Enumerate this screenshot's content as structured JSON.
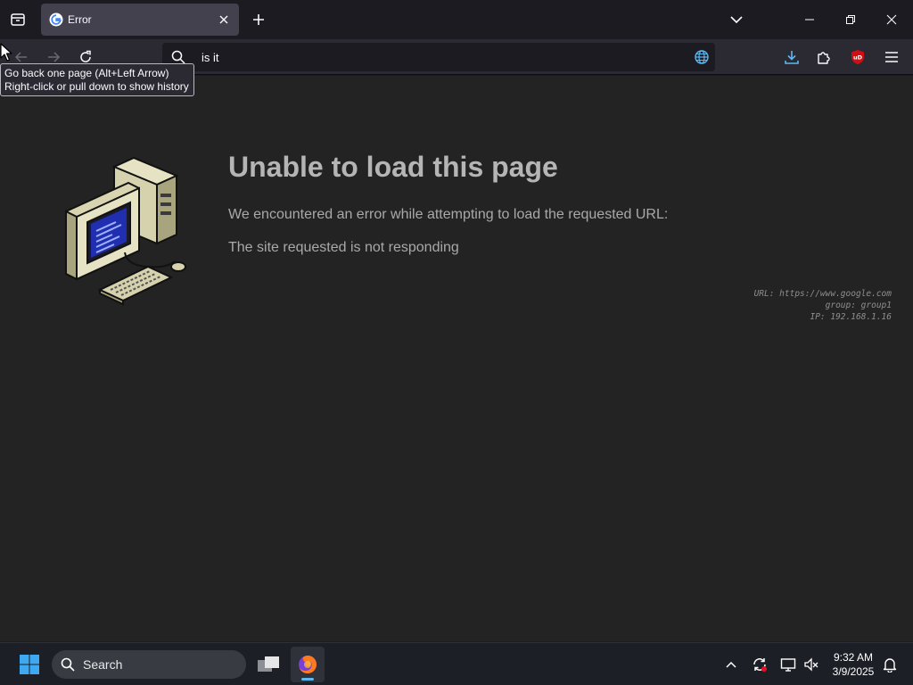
{
  "tab": {
    "title": "Error"
  },
  "urlbar": {
    "value": "is it"
  },
  "tooltip": {
    "line1": "Go back one page (Alt+Left Arrow)",
    "line2": "Right-click or pull down to show history"
  },
  "error": {
    "title": "Unable to load this page",
    "description": "We encountered an error while attempting to load the requested URL:",
    "reason": "The site requested is not responding",
    "url_line": "URL: https://www.google.com",
    "group_line": "group: group1",
    "ip_line": "IP: 192.168.1.16"
  },
  "taskbar": {
    "search_label": "Search",
    "time": "9:32 AM",
    "date": "3/9/2025"
  },
  "icons": {
    "list_all_tabs": "list-all-tabs-icon",
    "favicon": "google-g-icon",
    "close_tab": "close-icon",
    "new_tab": "plus-icon",
    "tab_overflow": "chevron-down-icon",
    "back": "back-arrow-icon",
    "forward": "forward-arrow-icon",
    "reload": "reload-icon",
    "search": "search-icon",
    "globe": "globe-icon",
    "downloads": "download-icon",
    "extensions": "puzzle-icon",
    "ublock": "ublock-origin-icon",
    "menu": "hamburger-menu-icon",
    "windows_start": "windows-logo-icon",
    "task_view": "task-view-icon",
    "firefox": "firefox-icon"
  },
  "colors": {
    "accent": "#5cb8f0",
    "content_bg": "#232323",
    "title_text": "#b5b5b5",
    "ublock_red": "#d10f13"
  }
}
